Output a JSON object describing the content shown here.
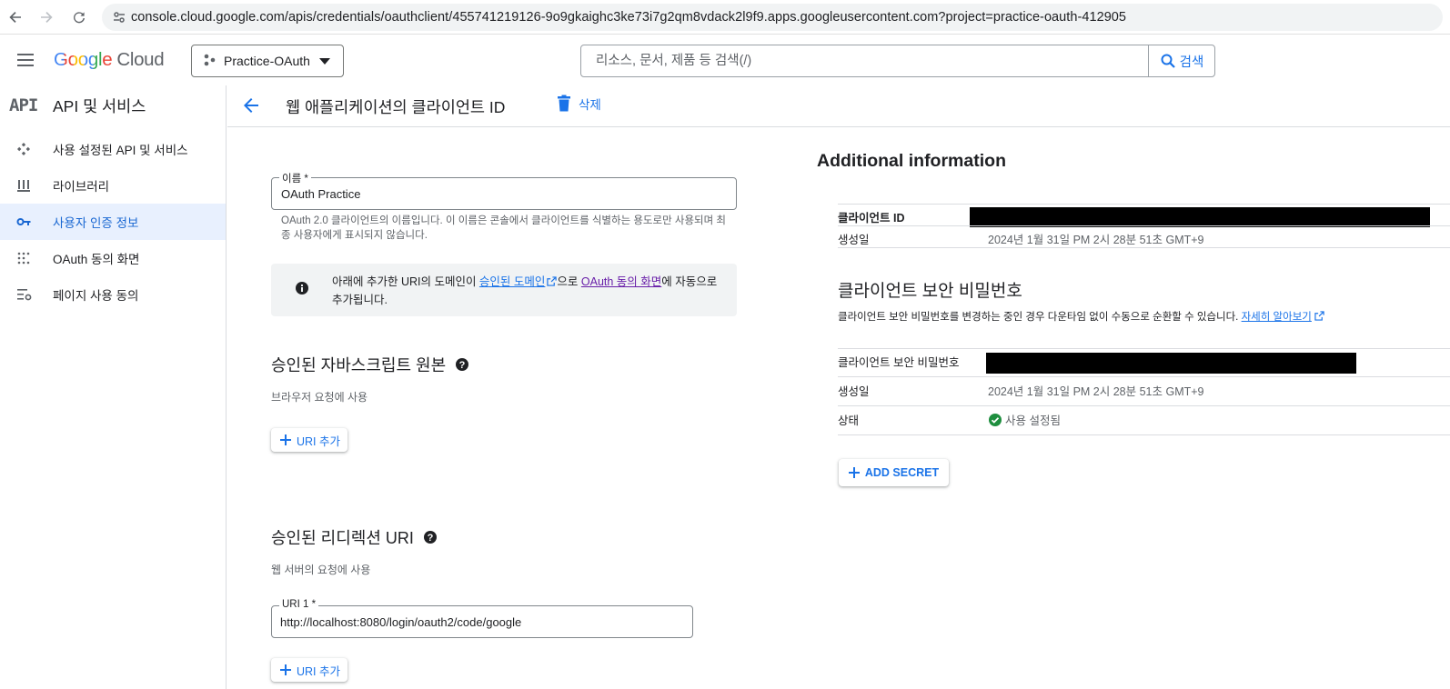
{
  "browser": {
    "url": "console.cloud.google.com/apis/credentials/oauthclient/455741219126-9o9gkaighc3ke73i7g2qm8vdack2l9f9.apps.googleusercontent.com?project=practice-oauth-412905"
  },
  "header": {
    "logo_google": "Google",
    "logo_cloud": "Cloud",
    "project_name": "Practice-OAuth",
    "search_placeholder": "리소스, 문서, 제품 등 검색(/)",
    "search_button": "검색"
  },
  "sidebar": {
    "logo_text": "API",
    "title": "API 및 서비스",
    "items": [
      {
        "label": "사용 설정된 API 및 서비스",
        "icon": "api-diamond-icon",
        "active": false
      },
      {
        "label": "라이브러리",
        "icon": "library-icon",
        "active": false
      },
      {
        "label": "사용자 인증 정보",
        "icon": "key-icon",
        "active": true
      },
      {
        "label": "OAuth 동의 화면",
        "icon": "consent-grid-icon",
        "active": false
      },
      {
        "label": "페이지 사용 동의",
        "icon": "settings-list-icon",
        "active": false
      }
    ]
  },
  "titlebar": {
    "title": "웹 애플리케이션의 클라이언트 ID",
    "delete_label": "삭제"
  },
  "form": {
    "name_label": "이름 *",
    "name_value": "OAuth Practice",
    "name_helper": "OAuth 2.0 클라이언트의 이름입니다. 이 이름은 콘솔에서 클라이언트를 식별하는 용도로만 사용되며 최종 사용자에게 표시되지 않습니다.",
    "info_prefix": "아래에 추가한 URI의 도메인이 ",
    "info_link1": "승인된 도메인",
    "info_mid": "으로 ",
    "info_link2": "OAuth 동의 화면",
    "info_suffix": "에 자동으로 추가됩니다.",
    "js_origins_title": "승인된 자바스크립트 원본",
    "js_origins_sub": "브라우저 요청에 사용",
    "add_uri_label": "URI 추가",
    "redirect_title": "승인된 리디렉션 URI",
    "redirect_sub": "웹 서버의 요청에 사용",
    "uri1_label": "URI 1 *",
    "uri1_value": "http://localhost:8080/login/oauth2/code/google",
    "add_uri_label2": "URI 추가"
  },
  "additional": {
    "heading": "Additional information",
    "client_id_label": "클라이언트 ID",
    "created_label": "생성일",
    "created_value": "2024년 1월 31일 PM 2시 28분 51초 GMT+9",
    "secret_heading": "클라이언트 보안 비밀번호",
    "secret_desc": "클라이언트 보안 비밀번호를 변경하는 중인 경우 다운타임 없이 수동으로 순환할 수 있습니다.",
    "learn_more": "자세히 알아보기",
    "secret_label": "클라이언트 보안 비밀번호",
    "secret_created_label": "생성일",
    "secret_created_value": "2024년 1월 31일 PM 2시 28분 51초 GMT+9",
    "status_label": "상태",
    "status_value": "사용 설정됨",
    "add_secret": "ADD SECRET"
  },
  "colors": {
    "accent": "#1a73e8",
    "active_bg": "#e8f0fe",
    "success": "#1e8e3e",
    "link_visited": "#681da8"
  }
}
